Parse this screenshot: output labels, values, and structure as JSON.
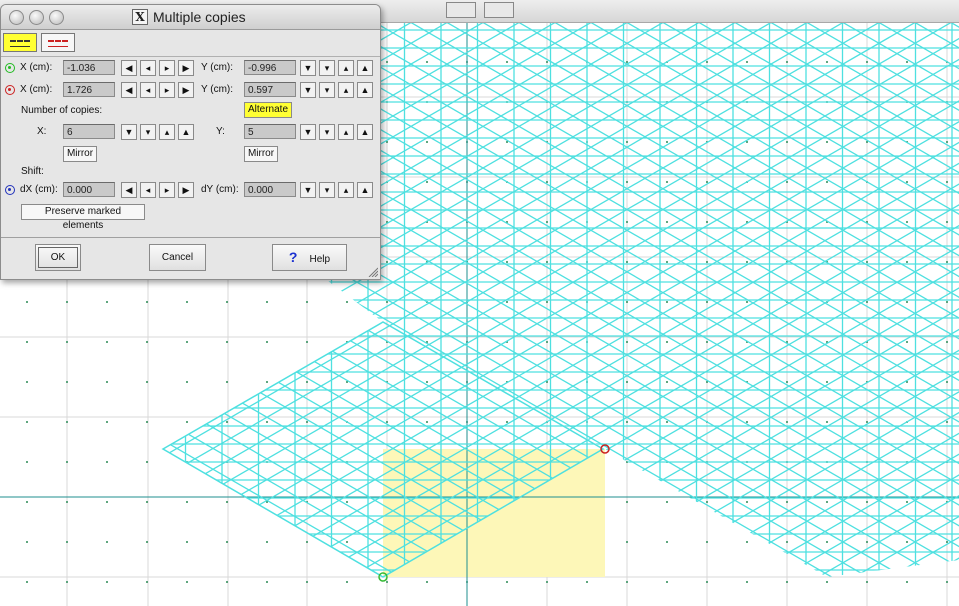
{
  "dialog": {
    "title": "Multiple copies",
    "title_icon_glyph": "X",
    "point1": {
      "x_label": "X (cm):",
      "x_value": "-1.036",
      "y_label": "Y (cm):",
      "y_value": "-0.996",
      "color": "#22bb22"
    },
    "point2": {
      "x_label": "X (cm):",
      "x_value": "1.726",
      "y_label": "Y (cm):",
      "y_value": "0.597",
      "color": "#cc2222"
    },
    "copies": {
      "label": "Number of copies:",
      "alternate_label": "Alternate",
      "x_label": "X:",
      "x_value": "6",
      "y_label": "Y:",
      "y_value": "5",
      "mirror_x_label": "Mirror",
      "mirror_y_label": "Mirror"
    },
    "shift": {
      "label": "Shift:",
      "dx_label": "dX (cm):",
      "dx_value": "0.000",
      "dy_label": "dY (cm):",
      "dy_value": "0.000",
      "color": "#2233bb"
    },
    "preserve_label": "Preserve marked elements",
    "ok_label": "OK",
    "cancel_label": "Cancel",
    "help_label": "Help",
    "help_glyph": "?",
    "arrows": {
      "first": "◀",
      "prev": "◂",
      "next": "▸",
      "last": "▶",
      "down_big": "▼",
      "down": "▾",
      "up": "▴",
      "up_big": "▲"
    }
  },
  "colors": {
    "pattern": "#4ee0e0",
    "selection": "#fdf7b8",
    "axis": "#1f8f8f",
    "grid": "#d8d8d8",
    "dot": "#2e8b57",
    "accent_yellow": "#ffff33"
  }
}
